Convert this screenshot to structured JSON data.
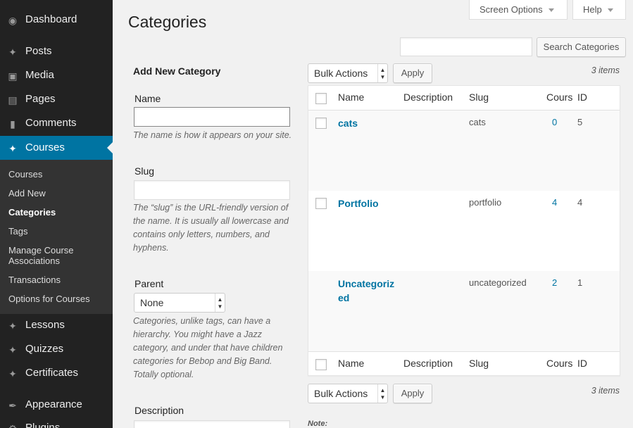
{
  "screen_meta": {
    "screen_options": "Screen Options",
    "help": "Help"
  },
  "sidebar": {
    "menu": [
      {
        "label": "Dashboard",
        "icon": "dashboard-icon"
      },
      {
        "label": "Posts",
        "icon": "pin-icon"
      },
      {
        "label": "Media",
        "icon": "media-icon"
      },
      {
        "label": "Pages",
        "icon": "pages-icon"
      },
      {
        "label": "Comments",
        "icon": "comment-icon"
      },
      {
        "label": "Courses",
        "icon": "pin-icon"
      },
      {
        "label": "Lessons",
        "icon": "pin-icon"
      },
      {
        "label": "Quizzes",
        "icon": "pin-icon"
      },
      {
        "label": "Certificates",
        "icon": "pin-icon"
      },
      {
        "label": "Appearance",
        "icon": "brush-icon"
      },
      {
        "label": "Plugins",
        "icon": "plug-icon"
      }
    ],
    "submenu": [
      "Courses",
      "Add New",
      "Categories",
      "Tags",
      "Manage Course Associations",
      "Transactions",
      "Options for Courses"
    ]
  },
  "page_title": "Categories",
  "search": {
    "button": "Search Categories",
    "value": ""
  },
  "form": {
    "heading": "Add New Category",
    "name_label": "Name",
    "name_desc": "The name is how it appears on your site.",
    "slug_label": "Slug",
    "slug_desc": "The “slug” is the URL-friendly version of the name. It is usually all lowercase and contains only letters, numbers, and hyphens.",
    "parent_label": "Parent",
    "parent_value": "None",
    "parent_desc": "Categories, unlike tags, can have a hierarchy. You might have a Jazz category, and under that have children categories for Bebop and Big Band. Totally optional.",
    "description_label": "Description"
  },
  "table": {
    "bulk_actions": "Bulk Actions",
    "apply": "Apply",
    "items_count": "3 items",
    "columns": [
      "Name",
      "Description",
      "Slug",
      "Courses",
      "ID"
    ],
    "rows": [
      {
        "name": "cats",
        "description": "",
        "slug": "cats",
        "count": "0",
        "id": "5"
      },
      {
        "name": "Portfolio",
        "description": "",
        "slug": "portfolio",
        "count": "4",
        "id": "4"
      },
      {
        "name": "Uncategorized",
        "description": "",
        "slug": "uncategorized",
        "count": "2",
        "id": "1"
      }
    ],
    "note": "Note:"
  },
  "colors": {
    "menu_bg": "#222222",
    "submenu_bg": "#333333",
    "accent": "#0074a2",
    "link": "#0074a2"
  }
}
